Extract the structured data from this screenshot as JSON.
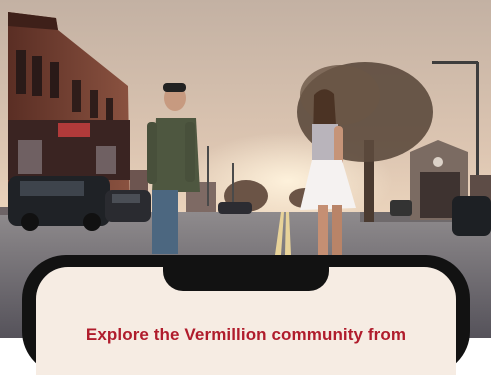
{
  "phone": {
    "tagline": "Explore the Vermillion community from"
  },
  "colors": {
    "tagline": "#b01c2c",
    "phone_frame": "#121212",
    "phone_screen": "#f6ece3",
    "sky_top": "#c9b7a8",
    "sky_horizon": "#f2dcc0"
  },
  "icons": {
    "hero_photo": "street-sunset-photo"
  }
}
